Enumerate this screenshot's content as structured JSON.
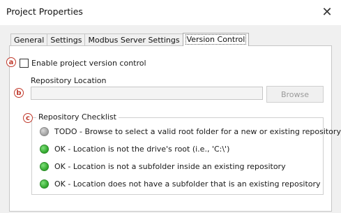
{
  "window": {
    "title": "Project Properties",
    "close_glyph": "✕"
  },
  "tabs": [
    {
      "label": "General",
      "active": false
    },
    {
      "label": "Settings",
      "active": false
    },
    {
      "label": "Modbus Server Settings",
      "active": false
    },
    {
      "label": "Version Control",
      "active": true
    }
  ],
  "badges": {
    "a": "a",
    "b": "b",
    "c": "c"
  },
  "version_control": {
    "enable_label": "Enable project version control",
    "enable_checked": false,
    "repo_location_label": "Repository Location",
    "repo_path_value": "",
    "browse_label": "Browse",
    "checklist_title": "Repository Checklist",
    "checklist": [
      {
        "status": "todo",
        "text": "TODO - Browse to select a valid root folder for a new or existing repository"
      },
      {
        "status": "ok",
        "text": "OK - Location is not the drive's root (i.e., 'C:\\')"
      },
      {
        "status": "ok",
        "text": "OK - Location is not a subfolder inside an existing repository"
      },
      {
        "status": "ok",
        "text": "OK - Location does not have a subfolder that is an existing repository"
      }
    ]
  },
  "colors": {
    "badge": "#c0392b",
    "ok": "#2fa52b",
    "todo": "#9e9e9e"
  }
}
